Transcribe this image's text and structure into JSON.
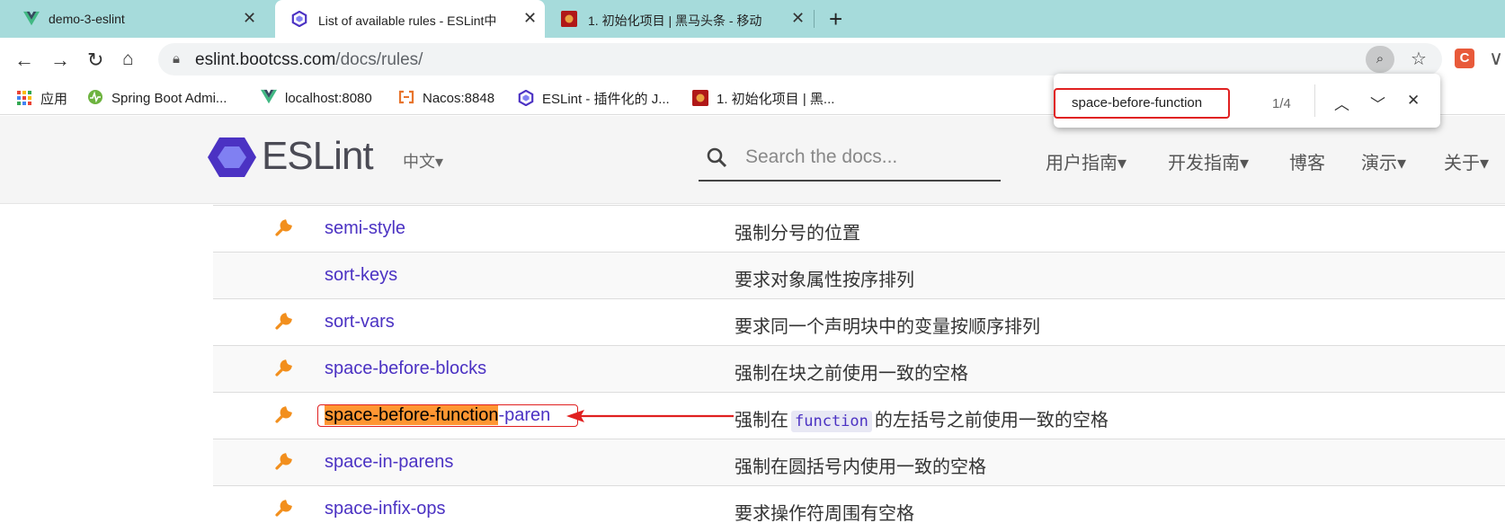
{
  "tabs": [
    {
      "title": "demo-3-eslint",
      "icon": "vue-logo-icon"
    },
    {
      "title": "List of available rules - ESLint中",
      "icon": "eslint-logo-icon",
      "active": true
    },
    {
      "title": "1. 初始化项目 | 黑马头条 - 移动",
      "icon": "heima-logo-icon"
    }
  ],
  "toolbar": {
    "url_domain": "eslint.bootcss.com",
    "url_path": "/docs/rules/"
  },
  "bookmarks": [
    {
      "label": "应用",
      "icon": "apps-grid-icon"
    },
    {
      "label": "Spring Boot Admi...",
      "icon": "spring-boot-admin-icon"
    },
    {
      "label": "localhost:8080",
      "icon": "vue-logo-icon"
    },
    {
      "label": "Nacos:8848",
      "icon": "nacos-icon"
    },
    {
      "label": "ESLint - 插件化的 J...",
      "icon": "eslint-logo-icon"
    },
    {
      "label": "1. 初始化项目 | 黑...",
      "icon": "heima-logo-icon"
    }
  ],
  "find": {
    "query": "space-before-function",
    "count": "1/4"
  },
  "site": {
    "brand": "ESLint",
    "lang": "中文▾",
    "search_placeholder": "Search the docs...",
    "nav": [
      "用户指南▾",
      "开发指南▾",
      "博客",
      "演示▾",
      "关于▾"
    ]
  },
  "rules": [
    {
      "name": "semi-style",
      "desc": "强制分号的位置",
      "fixable": true
    },
    {
      "name": "sort-keys",
      "desc": "要求对象属性按序排列",
      "fixable": false
    },
    {
      "name": "sort-vars",
      "desc": "要求同一个声明块中的变量按顺序排列",
      "fixable": true
    },
    {
      "name": "space-before-blocks",
      "desc": "强制在块之前使用一致的空格",
      "fixable": true
    },
    {
      "name_match": "space-before-function",
      "name_rest": "-paren",
      "desc_pre": "强制在",
      "desc_code": "function",
      "desc_post": "的左括号之前使用一致的空格",
      "fixable": true
    },
    {
      "name": "space-in-parens",
      "desc": "强制在圆括号内使用一致的空格",
      "fixable": true
    },
    {
      "name": "space-infix-ops",
      "desc": "要求操作符周围有空格",
      "fixable": true
    }
  ],
  "colors": {
    "accent": "#4b32c3",
    "highlight": "#ff9632",
    "annotation": "#e02020",
    "wrench": "#f28f1d"
  }
}
